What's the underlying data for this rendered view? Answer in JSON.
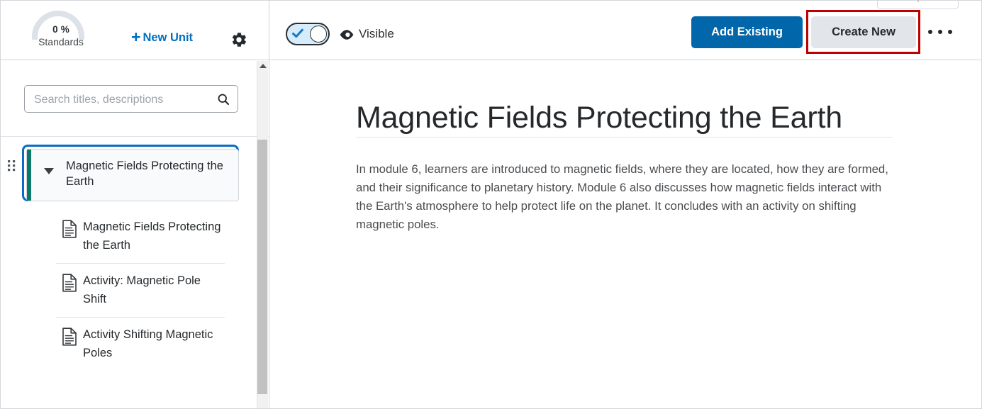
{
  "sidebar": {
    "gauge": {
      "percent": "0 %",
      "label": "Standards",
      "icon": "gauge-arc"
    },
    "new_unit_label": "New Unit",
    "new_unit_icon": "plus-icon",
    "settings_icon": "gear-icon",
    "search": {
      "placeholder": "Search titles, descriptions",
      "value": "",
      "icon": "search-icon"
    },
    "drag_handle_icon": "drag-handle-icon",
    "unit": {
      "title": "Magnetic Fields Protecting the Earth",
      "caret_icon": "caret-down-icon",
      "expanded": true,
      "accent_color": "#0b7a6b",
      "focus_color": "#0a6cc4"
    },
    "items": [
      {
        "label": "Magnetic Fields Protecting the Earth",
        "icon": "document-icon"
      },
      {
        "label": "Activity: Magnetic Pole Shift",
        "icon": "document-icon"
      },
      {
        "label": "Activity Shifting Magnetic Poles",
        "icon": "document-icon"
      }
    ],
    "scrollbar": {
      "up_icon": "scroll-up-arrow-icon"
    }
  },
  "header": {
    "visibility_toggle": {
      "state": "on",
      "check_icon": "check-icon",
      "knob": "toggle-knob"
    },
    "visible_icon": "eye-icon",
    "visible_label": "Visible",
    "chevron_icon": "chevron-down-icon",
    "add_existing_label": "Add Existing",
    "create_new_label": "Create New",
    "more_options_icon": "kebab-menu-icon",
    "accent_blue": "#0266ab",
    "create_new_bg": "#e2e6ea",
    "highlight_color": "#c00000"
  },
  "main": {
    "title": "Magnetic Fields Protecting the Earth",
    "description": "In module 6, learners are introduced to magnetic fields, where they are located, how they are formed, and their significance to planetary history. Module 6 also discusses how magnetic fields interact with the Earth's atmosphere to help protect life on the planet. It concludes with an activity on shifting magnetic poles."
  }
}
